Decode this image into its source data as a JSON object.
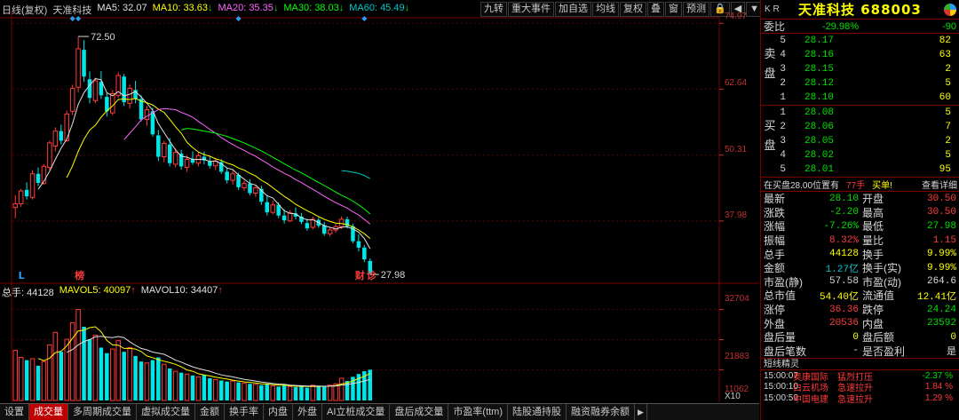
{
  "chart_header": {
    "period": "日线(复权)",
    "stock_name": "天准科技",
    "ma5": "MA5: 32.07",
    "ma10": "MA10: 33.63",
    "ma20": "MA20: 35.35",
    "ma30": "MA30: 38.03",
    "ma60": "MA60: 45.49",
    "arrow": "↓"
  },
  "toolbar": [
    "九转",
    "重大事件",
    "加自选",
    "均线",
    "复权",
    "叠",
    "窗",
    "预测",
    "🔒",
    "◀",
    "▼"
  ],
  "price_axis": [
    "74.97",
    "62.64",
    "50.31",
    "37.98"
  ],
  "price_marks": {
    "high": "72.50",
    "low": "27.98"
  },
  "chart_markers": {
    "l": "L",
    "bang": "榜",
    "cai": "财",
    "zhen": "诊"
  },
  "volume_header": {
    "total": "总手: 44128",
    "mavol5": "MAVOL5: 40097",
    "mavol10": "MAVOL10: 34407",
    "arrow": "↑"
  },
  "volume_axis": [
    "32704",
    "21883",
    "11062"
  ],
  "volume_unit": "X10",
  "bottom_tabs": [
    "设置",
    "成交量",
    "多周期成交量",
    "虚拟成交量",
    "金额",
    "换手率",
    "内盘",
    "外盘",
    "AI立桩成交量",
    "盘后成交量",
    "市盈率(ttm)",
    "陆股通持股",
    "融资融券余额"
  ],
  "active_tab": 1,
  "tab_arrow": "▶",
  "chart_data": {
    "type": "candlestick",
    "price_ylim": [
      27.98,
      74.97
    ],
    "price_ticks": [
      74.97,
      62.64,
      50.31,
      37.98
    ],
    "volume_ticks": [
      32704,
      21883,
      11062
    ],
    "candles": [
      [
        40.5,
        42.8,
        38.5,
        41.2
      ],
      [
        41.2,
        44.0,
        40.6,
        43.6
      ],
      [
        43.8,
        45.2,
        42.0,
        42.6
      ],
      [
        42.4,
        47.5,
        42.0,
        46.8
      ],
      [
        46.8,
        48.0,
        44.5,
        45.1
      ],
      [
        45.0,
        48.6,
        44.8,
        48.2
      ],
      [
        48.0,
        53.0,
        47.5,
        52.6
      ],
      [
        52.0,
        55.5,
        51.0,
        54.8
      ],
      [
        54.8,
        56.0,
        52.3,
        53.0
      ],
      [
        53.0,
        58.6,
        52.8,
        58.0
      ],
      [
        58.5,
        63.5,
        57.8,
        62.8
      ],
      [
        63.0,
        72.5,
        62.0,
        70.2
      ],
      [
        70.0,
        71.8,
        64.0,
        65.0
      ],
      [
        64.5,
        66.0,
        60.0,
        61.0
      ],
      [
        60.5,
        64.8,
        60.0,
        64.2
      ],
      [
        64.0,
        66.0,
        60.8,
        61.5
      ],
      [
        61.2,
        62.0,
        57.5,
        58.5
      ],
      [
        58.2,
        62.5,
        57.8,
        61.8
      ],
      [
        61.5,
        65.8,
        61.0,
        65.2
      ],
      [
        65.0,
        65.5,
        59.5,
        60.2
      ],
      [
        60.0,
        63.5,
        59.0,
        62.8
      ],
      [
        62.5,
        64.2,
        60.0,
        60.8
      ],
      [
        60.8,
        61.5,
        56.6,
        57.0
      ],
      [
        57.0,
        59.5,
        55.8,
        58.8
      ],
      [
        58.5,
        59.2,
        53.8,
        54.2
      ],
      [
        54.0,
        55.0,
        49.2,
        50.0
      ],
      [
        50.0,
        53.0,
        49.0,
        52.5
      ],
      [
        52.3,
        53.5,
        48.2,
        48.8
      ],
      [
        48.6,
        51.5,
        48.0,
        50.8
      ],
      [
        50.6,
        51.3,
        47.6,
        48.2
      ],
      [
        48.0,
        50.2,
        47.2,
        49.5
      ],
      [
        49.5,
        51.0,
        48.5,
        48.9
      ],
      [
        48.8,
        50.8,
        48.2,
        50.2
      ],
      [
        50.0,
        51.0,
        48.6,
        49.3
      ],
      [
        49.2,
        50.0,
        47.8,
        48.3
      ],
      [
        48.3,
        49.8,
        47.5,
        49.2
      ],
      [
        49.0,
        49.5,
        46.8,
        47.2
      ],
      [
        47.2,
        48.0,
        45.0,
        45.6
      ],
      [
        45.6,
        47.4,
        44.8,
        46.8
      ],
      [
        46.6,
        47.0,
        43.8,
        44.3
      ],
      [
        44.2,
        45.5,
        43.6,
        45.0
      ],
      [
        45.0,
        45.8,
        42.8,
        43.2
      ],
      [
        43.2,
        44.8,
        42.5,
        44.2
      ],
      [
        44.0,
        44.6,
        41.0,
        41.6
      ],
      [
        41.5,
        42.8,
        39.0,
        39.6
      ],
      [
        39.6,
        41.8,
        39.2,
        41.0
      ],
      [
        41.0,
        41.5,
        38.5,
        39.0
      ],
      [
        39.0,
        40.2,
        37.5,
        38.1
      ],
      [
        38.0,
        40.0,
        37.8,
        39.5
      ],
      [
        39.4,
        40.5,
        38.3,
        38.8
      ],
      [
        38.8,
        39.5,
        37.4,
        37.8
      ],
      [
        37.6,
        38.4,
        36.2,
        36.6
      ],
      [
        36.8,
        38.8,
        36.4,
        38.3
      ],
      [
        38.2,
        38.6,
        36.7,
        37.1
      ],
      [
        37.2,
        37.8,
        35.2,
        35.6
      ],
      [
        35.6,
        36.8,
        35.1,
        36.3
      ],
      [
        36.3,
        37.5,
        35.8,
        36.9
      ],
      [
        36.9,
        38.8,
        36.5,
        38.3
      ],
      [
        38.3,
        38.8,
        36.6,
        37.0
      ],
      [
        37.0,
        37.5,
        33.8,
        34.2
      ],
      [
        34.2,
        35.5,
        32.3,
        33.0
      ],
      [
        33.0,
        33.5,
        30.3,
        30.8
      ],
      [
        30.5,
        31.0,
        27.98,
        28.1
      ]
    ],
    "ma_series": [
      {
        "key": "MA5",
        "color": "#e0e0e0",
        "values": [
          null,
          null,
          null,
          null,
          43.9,
          45.4,
          47.3,
          49.5,
          51.6,
          53.3,
          56.2,
          59.8,
          62.0,
          63.4,
          64.6,
          64.4,
          62.0,
          61.4,
          62.2,
          61.4,
          61.7,
          62.2,
          61.2,
          60.0,
          58.7,
          56.2,
          54.5,
          52.9,
          51.3,
          50.1,
          49.9,
          49.5,
          49.5,
          49.5,
          49.1,
          49.2,
          48.7,
          47.9,
          47.6,
          46.6,
          45.8,
          45.0,
          44.7,
          43.7,
          42.7,
          42.3,
          41.1,
          39.9,
          39.4,
          39.3,
          38.6,
          38.2,
          38.2,
          37.7,
          37.1,
          36.8,
          36.5,
          36.8,
          36.9,
          36.5,
          35.9,
          34.7,
          32.8
        ]
      },
      {
        "key": "MA10",
        "color": "#ffff00",
        "values": [
          null,
          null,
          null,
          null,
          null,
          null,
          null,
          null,
          null,
          46.1,
          48.3,
          51.0,
          53.3,
          55.0,
          55.9,
          57.4,
          58.6,
          59.5,
          60.7,
          60.8,
          60.7,
          60.9,
          60.4,
          60.1,
          59.7,
          58.9,
          58.3,
          57.0,
          55.6,
          54.4,
          52.7,
          51.7,
          50.9,
          50.4,
          50.1,
          49.6,
          49.3,
          48.8,
          48.5,
          47.9,
          47.5,
          46.9,
          46.4,
          45.6,
          45.0,
          44.2,
          43.4,
          42.6,
          41.9,
          41.1,
          40.5,
          39.9,
          39.4,
          38.8,
          38.3,
          37.9,
          37.6,
          37.5,
          37.3,
          36.9,
          36.3,
          35.6,
          34.7
        ]
      },
      {
        "key": "MA20",
        "color": "#ff66ff",
        "values": [
          null,
          null,
          null,
          null,
          null,
          null,
          null,
          null,
          null,
          null,
          null,
          null,
          null,
          null,
          null,
          null,
          null,
          null,
          null,
          53.2,
          54.4,
          55.6,
          56.9,
          57.6,
          58.2,
          58.8,
          59.0,
          58.9,
          58.8,
          58.3,
          57.9,
          57.4,
          56.6,
          55.9,
          55.1,
          54.4,
          53.6,
          52.9,
          52.3,
          51.7,
          51.2,
          50.6,
          50.1,
          49.4,
          48.8,
          48.1,
          47.5,
          46.9,
          46.4,
          45.7,
          45.2,
          44.5,
          43.9,
          43.3,
          42.6,
          42.0,
          41.4,
          40.9,
          40.4,
          39.7,
          39.1,
          38.3,
          37.4
        ]
      },
      {
        "key": "MA30",
        "color": "#00ff00",
        "values": [
          null,
          null,
          null,
          null,
          null,
          null,
          null,
          null,
          null,
          null,
          null,
          null,
          null,
          null,
          null,
          null,
          null,
          null,
          null,
          null,
          null,
          null,
          null,
          null,
          null,
          null,
          null,
          null,
          null,
          55.0,
          55.3,
          55.2,
          55.0,
          54.8,
          54.6,
          54.4,
          54.1,
          53.8,
          53.4,
          53.0,
          52.6,
          52.1,
          51.6,
          51.1,
          50.5,
          49.9,
          49.3,
          48.7,
          48.1,
          47.5,
          47.0,
          46.4,
          45.8,
          45.2,
          44.6,
          44.0,
          43.4,
          42.8,
          42.3,
          41.7,
          41.0,
          40.2,
          39.3
        ]
      },
      {
        "key": "MA60",
        "color": "#00c8c8",
        "values": [
          null,
          null,
          null,
          null,
          null,
          null,
          null,
          null,
          null,
          null,
          null,
          null,
          null,
          null,
          null,
          null,
          null,
          null,
          null,
          null,
          null,
          null,
          null,
          null,
          null,
          null,
          null,
          null,
          null,
          null,
          null,
          null,
          null,
          null,
          null,
          null,
          null,
          null,
          null,
          null,
          null,
          null,
          null,
          null,
          null,
          null,
          null,
          null,
          null,
          null,
          null,
          null,
          null,
          null,
          null,
          null,
          null,
          47.4,
          47.3,
          47.1,
          46.9,
          46.5,
          45.9
        ]
      }
    ],
    "volumes": [
      18000,
      15500,
      14500,
      15000,
      12500,
      14000,
      20000,
      24500,
      17500,
      22000,
      28000,
      32704,
      26500,
      22000,
      23500,
      19000,
      17000,
      18500,
      21500,
      17500,
      19000,
      16000,
      14000,
      13500,
      14500,
      15500,
      13000,
      11500,
      10500,
      10000,
      9500,
      9000,
      8500,
      9200,
      8000,
      7500,
      7200,
      6800,
      7000,
      6500,
      6200,
      6000,
      5800,
      5500,
      5800,
      5200,
      5000,
      5500,
      5000,
      4800,
      5200,
      4600,
      5500,
      5000,
      5000,
      5500,
      6000,
      8000,
      7000,
      8500,
      9500,
      10500,
      11062
    ],
    "mavol5": [
      null,
      null,
      null,
      null,
      15100,
      14300,
      15200,
      17200,
      17700,
      19600,
      22400,
      25000,
      25300,
      26200,
      26500,
      24700,
      21600,
      20000,
      19900,
      18700,
      18700,
      18500,
      17600,
      16000,
      15400,
      14700,
      14100,
      13600,
      13000,
      12100,
      11000,
      10500,
      9600,
      9200,
      8800,
      8400,
      8000,
      7700,
      7300,
      7000,
      6700,
      6500,
      6300,
      6000,
      5900,
      5700,
      5500,
      5500,
      5300,
      5100,
      5100,
      5000,
      5000,
      5000,
      5100,
      5100,
      5400,
      5900,
      6300,
      7000,
      7900,
      8700,
      9700
    ],
    "mavol10": [
      null,
      null,
      null,
      null,
      null,
      null,
      null,
      null,
      null,
      17300,
      18300,
      20000,
      21200,
      21900,
      22900,
      23100,
      22800,
      22600,
      23000,
      22600,
      21100,
      19800,
      18700,
      18200,
      17400,
      17000,
      16600,
      15600,
      14500,
      13800,
      12900,
      12100,
      11500,
      11000,
      10500,
      9800,
      9200,
      8800,
      8500,
      8000,
      7600,
      7300,
      7000,
      6600,
      6400,
      6100,
      5900,
      5800,
      5500,
      5400,
      5300,
      5200,
      5200,
      5200,
      5100,
      5200,
      5200,
      5500,
      5700,
      6100,
      6500,
      7000,
      7600
    ]
  },
  "quote_panel": {
    "kr": "K R",
    "title": "天准科技 688003",
    "webi_label": "委比",
    "webi_pct": "-29.98%",
    "webi_diff": "-90",
    "sell_label": [
      "卖",
      "盘"
    ],
    "buy_label": [
      "买",
      "盘"
    ],
    "asks": [
      {
        "lvl": "5",
        "price": "28.17",
        "vol": "82"
      },
      {
        "lvl": "4",
        "price": "28.16",
        "vol": "63"
      },
      {
        "lvl": "3",
        "price": "28.15",
        "vol": "2"
      },
      {
        "lvl": "2",
        "price": "28.12",
        "vol": "5"
      },
      {
        "lvl": "1",
        "price": "28.10",
        "vol": "60"
      }
    ],
    "bids": [
      {
        "lvl": "1",
        "price": "28.08",
        "vol": "5"
      },
      {
        "lvl": "2",
        "price": "28.06",
        "vol": "7"
      },
      {
        "lvl": "3",
        "price": "28.05",
        "vol": "2"
      },
      {
        "lvl": "4",
        "price": "28.02",
        "vol": "5"
      },
      {
        "lvl": "5",
        "price": "28.01",
        "vol": "95"
      }
    ],
    "bid_info": {
      "text": "在买盘28.00位置有",
      "vol": "77手",
      "action": "买单!",
      "link": "查看详细"
    },
    "stats": [
      {
        "l": "最新",
        "v": "28.10",
        "vc": "green",
        "l2": "开盘",
        "v2": "30.50",
        "v2c": "red"
      },
      {
        "l": "涨跌",
        "v": "-2.20",
        "vc": "green",
        "l2": "最高",
        "v2": "30.50",
        "v2c": "red"
      },
      {
        "l": "涨幅",
        "v": "-7.26%",
        "vc": "green",
        "l2": "最低",
        "v2": "27.98",
        "v2c": "green"
      },
      {
        "l": "振幅",
        "v": "8.32%",
        "vc": "red",
        "l2": "量比",
        "v2": "1.15",
        "v2c": "red"
      },
      {
        "l": "总手",
        "v": "44128",
        "vc": "yellow",
        "l2": "换手",
        "v2": "9.99%",
        "v2c": "yellow"
      },
      {
        "l": "金额",
        "v": "1.27亿",
        "vc": "cyan",
        "l2": "换手(实)",
        "v2": "9.99%",
        "v2c": "yellow"
      },
      {
        "l": "市盈(静)",
        "v": "57.58",
        "vc": "white",
        "l2": "市盈(动)",
        "v2": "264.6",
        "v2c": "white"
      },
      {
        "l": "总市值",
        "v": "54.40亿",
        "vc": "yellow",
        "l2": "流通值",
        "v2": "12.41亿",
        "v2c": "yellow"
      },
      {
        "l": "涨停",
        "v": "36.36",
        "vc": "red",
        "l2": "跌停",
        "v2": "24.24",
        "v2c": "green"
      },
      {
        "l": "外盘",
        "v": "20536",
        "vc": "red",
        "l2": "内盘",
        "v2": "23592",
        "v2c": "green"
      },
      {
        "l": "盘后量",
        "v": "0",
        "vc": "yellow",
        "l2": "盘后额",
        "v2": "0",
        "v2c": "yellow"
      },
      {
        "l": "盘后笔数",
        "v": "-",
        "vc": "white",
        "l2": "是否盈利",
        "v2": "是",
        "v2c": "white"
      }
    ],
    "news_header": "短线精灵",
    "news": [
      {
        "t": "15:00:07",
        "n": "奥康国际",
        "e": "猛烈打压",
        "p": "-2.37 %",
        "ec": "red",
        "pc": "green"
      },
      {
        "t": "15:00:10",
        "n": "白云机场",
        "e": "急速拉升",
        "p": "1.84 %",
        "ec": "red",
        "pc": "red"
      },
      {
        "t": "15:00:59",
        "n": "中国电建",
        "e": "急速拉升",
        "p": "1.29 %",
        "ec": "red",
        "pc": "red"
      }
    ]
  }
}
